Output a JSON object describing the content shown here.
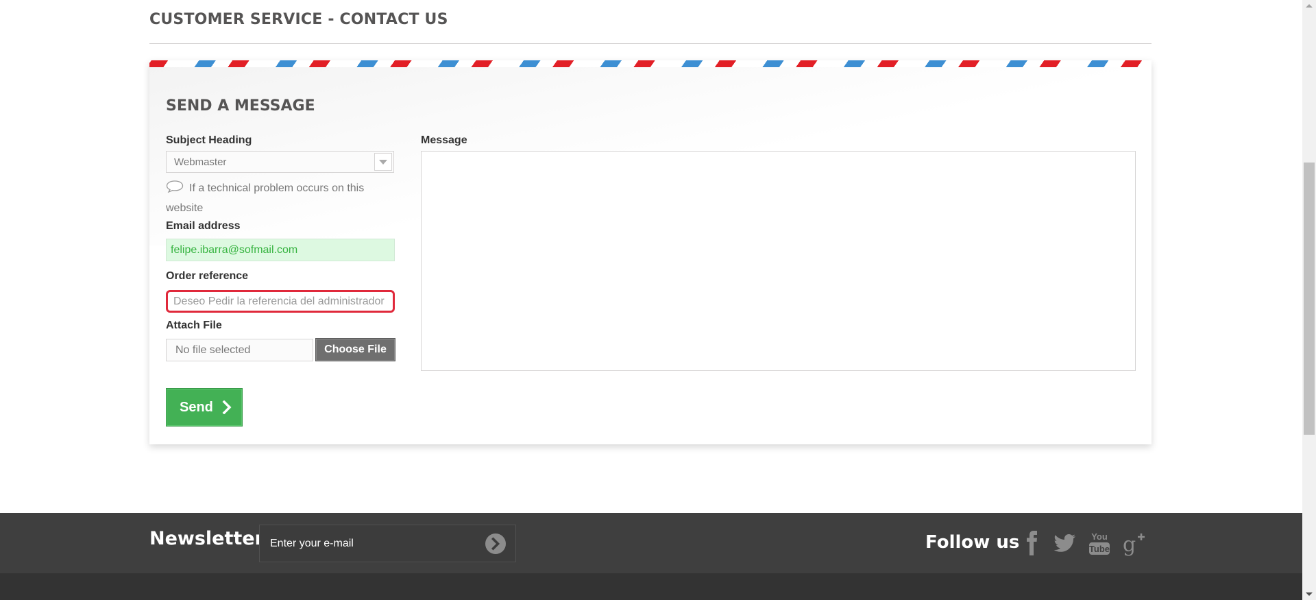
{
  "page": {
    "title": "CUSTOMER SERVICE - CONTACT US"
  },
  "form": {
    "title": "SEND A MESSAGE",
    "subject": {
      "label": "Subject Heading",
      "selected": "Webmaster",
      "hint": "If a technical problem occurs on this website"
    },
    "email": {
      "label": "Email address",
      "value": "felipe.ibarra@sofmail.com"
    },
    "order": {
      "label": "Order reference",
      "value": "Deseo Pedir la referencia del administrador"
    },
    "attach": {
      "label": "Attach File",
      "filename": "No file selected",
      "button": "Choose File"
    },
    "message": {
      "label": "Message",
      "value": ""
    },
    "send_label": "Send"
  },
  "footer": {
    "newsletter_title": "Newsletter",
    "newsletter_placeholder": "Enter your e-mail",
    "follow_title": "Follow us",
    "social": [
      "facebook-icon",
      "twitter-icon",
      "youtube-icon",
      "google-plus-icon"
    ]
  },
  "colors": {
    "accent_green": "#43b155",
    "error_red": "#e0293b",
    "valid_green": "#35b33f",
    "stripe_red": "#e21f26",
    "stripe_blue": "#3d8fd3",
    "footer_bg": "#3f3f3f"
  }
}
